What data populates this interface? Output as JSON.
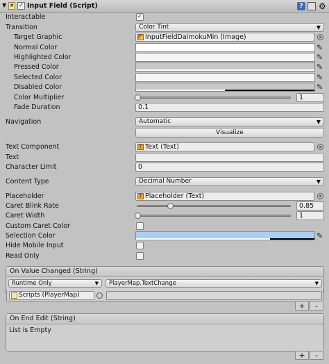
{
  "header": {
    "title": "Input Field (Script)",
    "enabled": "✓"
  },
  "props": {
    "interactable_label": "Interactable",
    "interactable_check": "✓",
    "transition_label": "Transition",
    "transition_value": "Color Tint",
    "target_graphic_label": "Target Graphic",
    "target_graphic_value": "InputFieldDaimokuMin (Image)",
    "normal_color_label": "Normal Color",
    "highlighted_color_label": "Highlighted Color",
    "pressed_color_label": "Pressed Color",
    "selected_color_label": "Selected Color",
    "disabled_color_label": "Disabled Color",
    "color_multiplier_label": "Color Multiplier",
    "color_multiplier_value": "1",
    "color_multiplier_fraction": 0.0,
    "fade_duration_label": "Fade Duration",
    "fade_duration_value": "0.1",
    "navigation_label": "Navigation",
    "navigation_value": "Automatic",
    "visualize_label": "Visualize",
    "text_component_label": "Text Component",
    "text_component_value": "Text (Text)",
    "text_label": "Text",
    "text_value": "",
    "character_limit_label": "Character Limit",
    "character_limit_value": "0",
    "content_type_label": "Content Type",
    "content_type_value": "Decimal Number",
    "placeholder_label": "Placeholder",
    "placeholder_value": "Placeholder (Text)",
    "caret_blink_rate_label": "Caret Blink Rate",
    "caret_blink_rate_value": "0.85",
    "caret_blink_rate_fraction": 0.21,
    "caret_width_label": "Caret Width",
    "caret_width_value": "1",
    "caret_width_fraction": 0.0,
    "custom_caret_color_label": "Custom Caret Color",
    "selection_color_label": "Selection Color",
    "selection_color_hex": "#a8cef7",
    "hide_mobile_input_label": "Hide Mobile Input",
    "read_only_label": "Read Only"
  },
  "on_value_changed": {
    "title": "On Value Changed (String)",
    "runtime": "Runtime Only",
    "function": "PlayerMap.TextChange",
    "object": "Scripts (PlayerMap)",
    "plus": "+",
    "minus": "-"
  },
  "on_end_edit": {
    "title": "On End Edit (String)",
    "empty": "List is Empty",
    "plus": "+",
    "minus": "-"
  },
  "icons": {
    "help": "?",
    "settings": "⚙",
    "arrow": "▼",
    "eyedropper": "✎"
  }
}
